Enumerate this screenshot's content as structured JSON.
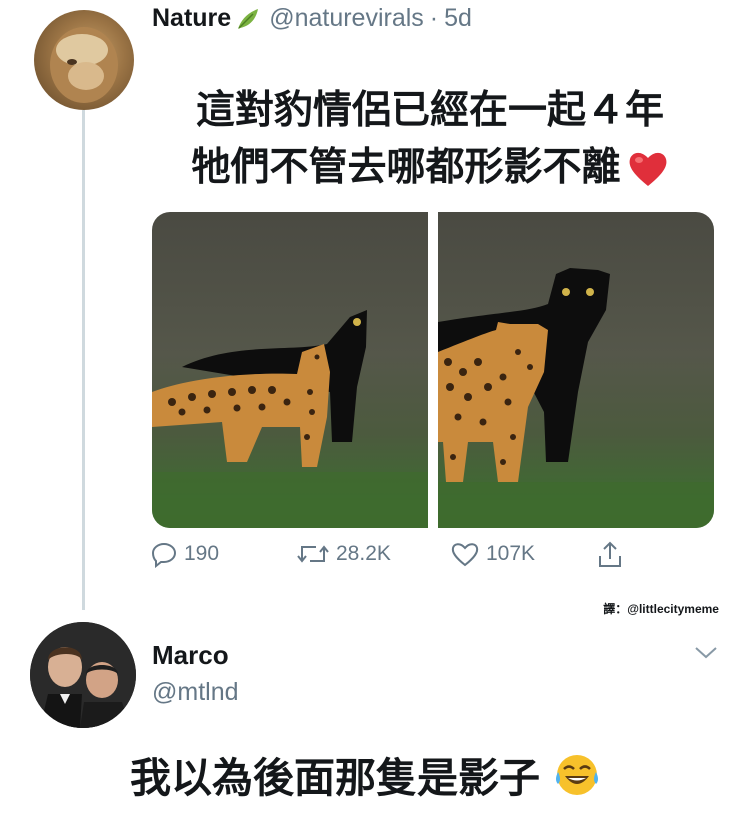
{
  "tweet": {
    "author_name": "Nature",
    "verified_icon": "leaf-icon",
    "handle": "@naturevirals",
    "separator": "·",
    "age": "5d",
    "text_line1": "這對豹情侶已經在一起４年",
    "text_line2": "牠們不管去哪都形影不離",
    "emoji": "heart-icon",
    "images": [
      "leopard-pair-photo-left",
      "leopard-pair-photo-right"
    ],
    "actions": {
      "replies": "190",
      "retweets": "28.2K",
      "likes": "107K"
    }
  },
  "translator_credit": "譯：@littlecitymeme",
  "reply": {
    "author_name": "Marco",
    "handle": "@mtlnd",
    "text": "我以為後面那隻是影子",
    "emoji": "tears-of-joy-icon"
  },
  "colors": {
    "secondary_text": "#657786",
    "thread_line": "#cfd9de",
    "heart": "#e0245e"
  }
}
